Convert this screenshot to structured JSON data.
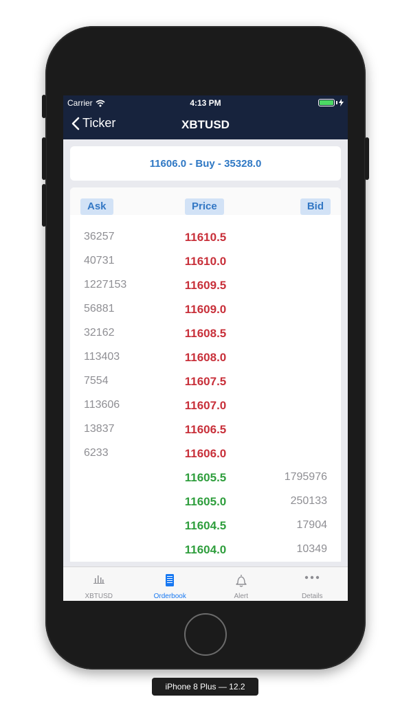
{
  "status_bar": {
    "carrier": "Carrier",
    "time": "4:13 PM"
  },
  "nav": {
    "back_label": "Ticker",
    "title": "XBTUSD"
  },
  "summary": {
    "text": "11606.0 - Buy - 35328.0"
  },
  "orderbook": {
    "headers": {
      "ask": "Ask",
      "price": "Price",
      "bid": "Bid"
    },
    "asks": [
      {
        "qty": "36257",
        "price": "11610.5"
      },
      {
        "qty": "40731",
        "price": "11610.0"
      },
      {
        "qty": "1227153",
        "price": "11609.5"
      },
      {
        "qty": "56881",
        "price": "11609.0"
      },
      {
        "qty": "32162",
        "price": "11608.5"
      },
      {
        "qty": "113403",
        "price": "11608.0"
      },
      {
        "qty": "7554",
        "price": "11607.5"
      },
      {
        "qty": "113606",
        "price": "11607.0"
      },
      {
        "qty": "13837",
        "price": "11606.5"
      },
      {
        "qty": "6233",
        "price": "11606.0"
      }
    ],
    "bids": [
      {
        "price": "11605.5",
        "qty": "1795976"
      },
      {
        "price": "11605.0",
        "qty": "250133"
      },
      {
        "price": "11604.5",
        "qty": "17904"
      },
      {
        "price": "11604.0",
        "qty": "10349"
      }
    ]
  },
  "tabs": [
    {
      "label": "XBTUSD",
      "icon": "chart-icon",
      "active": false
    },
    {
      "label": "Orderbook",
      "icon": "book-icon",
      "active": true
    },
    {
      "label": "Alert",
      "icon": "bell-icon",
      "active": false
    },
    {
      "label": "Details",
      "icon": "more-icon",
      "active": false
    }
  ],
  "device_caption": "iPhone 8 Plus — 12.2",
  "colors": {
    "nav_background": "#17233d",
    "accent_blue": "#2f78c4",
    "sell_red": "#c8303a",
    "buy_green": "#2f9e3d",
    "tab_active": "#1778f2"
  }
}
